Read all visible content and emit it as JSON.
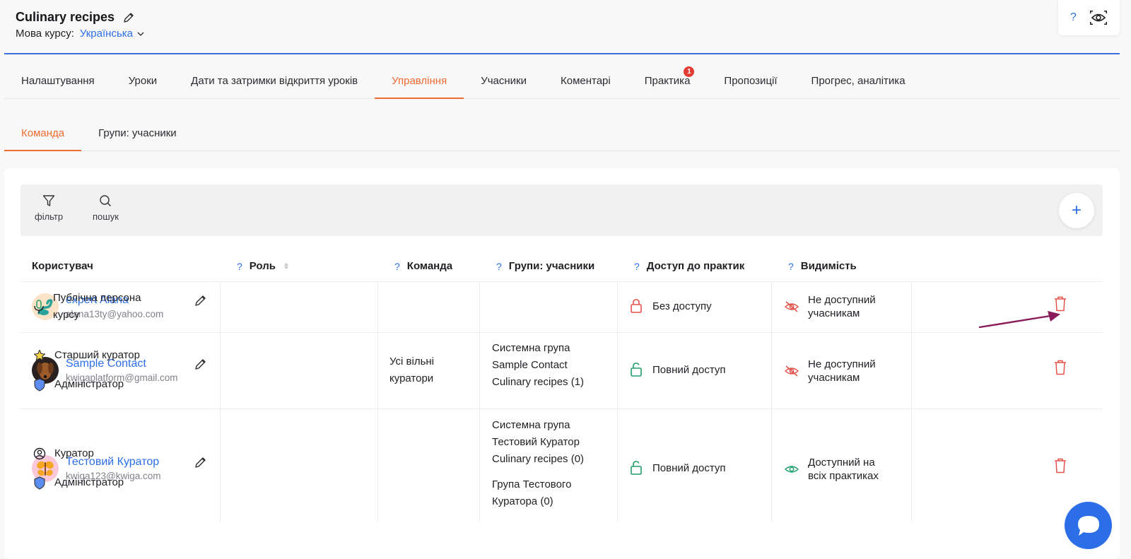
{
  "header": {
    "course_title": "Culinary recipes",
    "lang_label": "Мова курсу:",
    "lang_value": "Українська",
    "help_label": "?"
  },
  "main_tabs": [
    {
      "label": "Налаштування"
    },
    {
      "label": "Уроки"
    },
    {
      "label": "Дати та затримки відкриття уроків"
    },
    {
      "label": "Управління"
    },
    {
      "label": "Учасники"
    },
    {
      "label": "Коментарі"
    },
    {
      "label": "Практика",
      "badge": "1"
    },
    {
      "label": "Пропозиції"
    },
    {
      "label": "Прогрес, аналітика"
    }
  ],
  "sub_tabs": [
    {
      "label": "Команда"
    },
    {
      "label": "Групи: учасники"
    }
  ],
  "toolbar": {
    "filter_label": "фільтр",
    "search_label": "пошук",
    "add_label": "+"
  },
  "table": {
    "headers": {
      "user": "Користувач",
      "role": "Роль",
      "team": "Команда",
      "groups": "Групи: учасники",
      "practice_access": "Доступ до практик",
      "visibility": "Видимість",
      "help": "?"
    },
    "rows": [
      {
        "name": "expert Alana",
        "email": "alana13ty@yahoo.com",
        "roles": [
          "Публічна персона",
          "курсу"
        ],
        "team": "",
        "access": "Без доступу",
        "visibility": [
          "Не доступний",
          "учасникам"
        ]
      },
      {
        "name": "Sample Contact",
        "email": "kwigaplatform@gmail.com",
        "roles": [
          "Старший куратор",
          "Адміністратор"
        ],
        "team": [
          "Усі вільні",
          "куратори"
        ],
        "groups": [
          "Системна група",
          "Sample Contact",
          "Culinary recipes (1)"
        ],
        "access": "Повний доступ",
        "visibility": [
          "Не доступний",
          "учасникам"
        ]
      },
      {
        "name": "Тестовий Куратор",
        "email": "kwiga123@kwiga.com",
        "roles": [
          "Куратор",
          "Адміністратор"
        ],
        "groups": [
          "Системна група",
          "Тестовий Куратор",
          "Culinary recipes (0)"
        ],
        "groups2": [
          "Група Тестового",
          "Куратора (0)"
        ],
        "access": "Повний доступ",
        "visibility": [
          "Доступний на",
          "всіх практиках"
        ]
      }
    ]
  },
  "colors": {
    "accent": "#f26b2f",
    "link": "#2c6ee8",
    "danger": "#e3524b",
    "success": "#1f9f6b",
    "arrow": "#8b1a5a"
  }
}
